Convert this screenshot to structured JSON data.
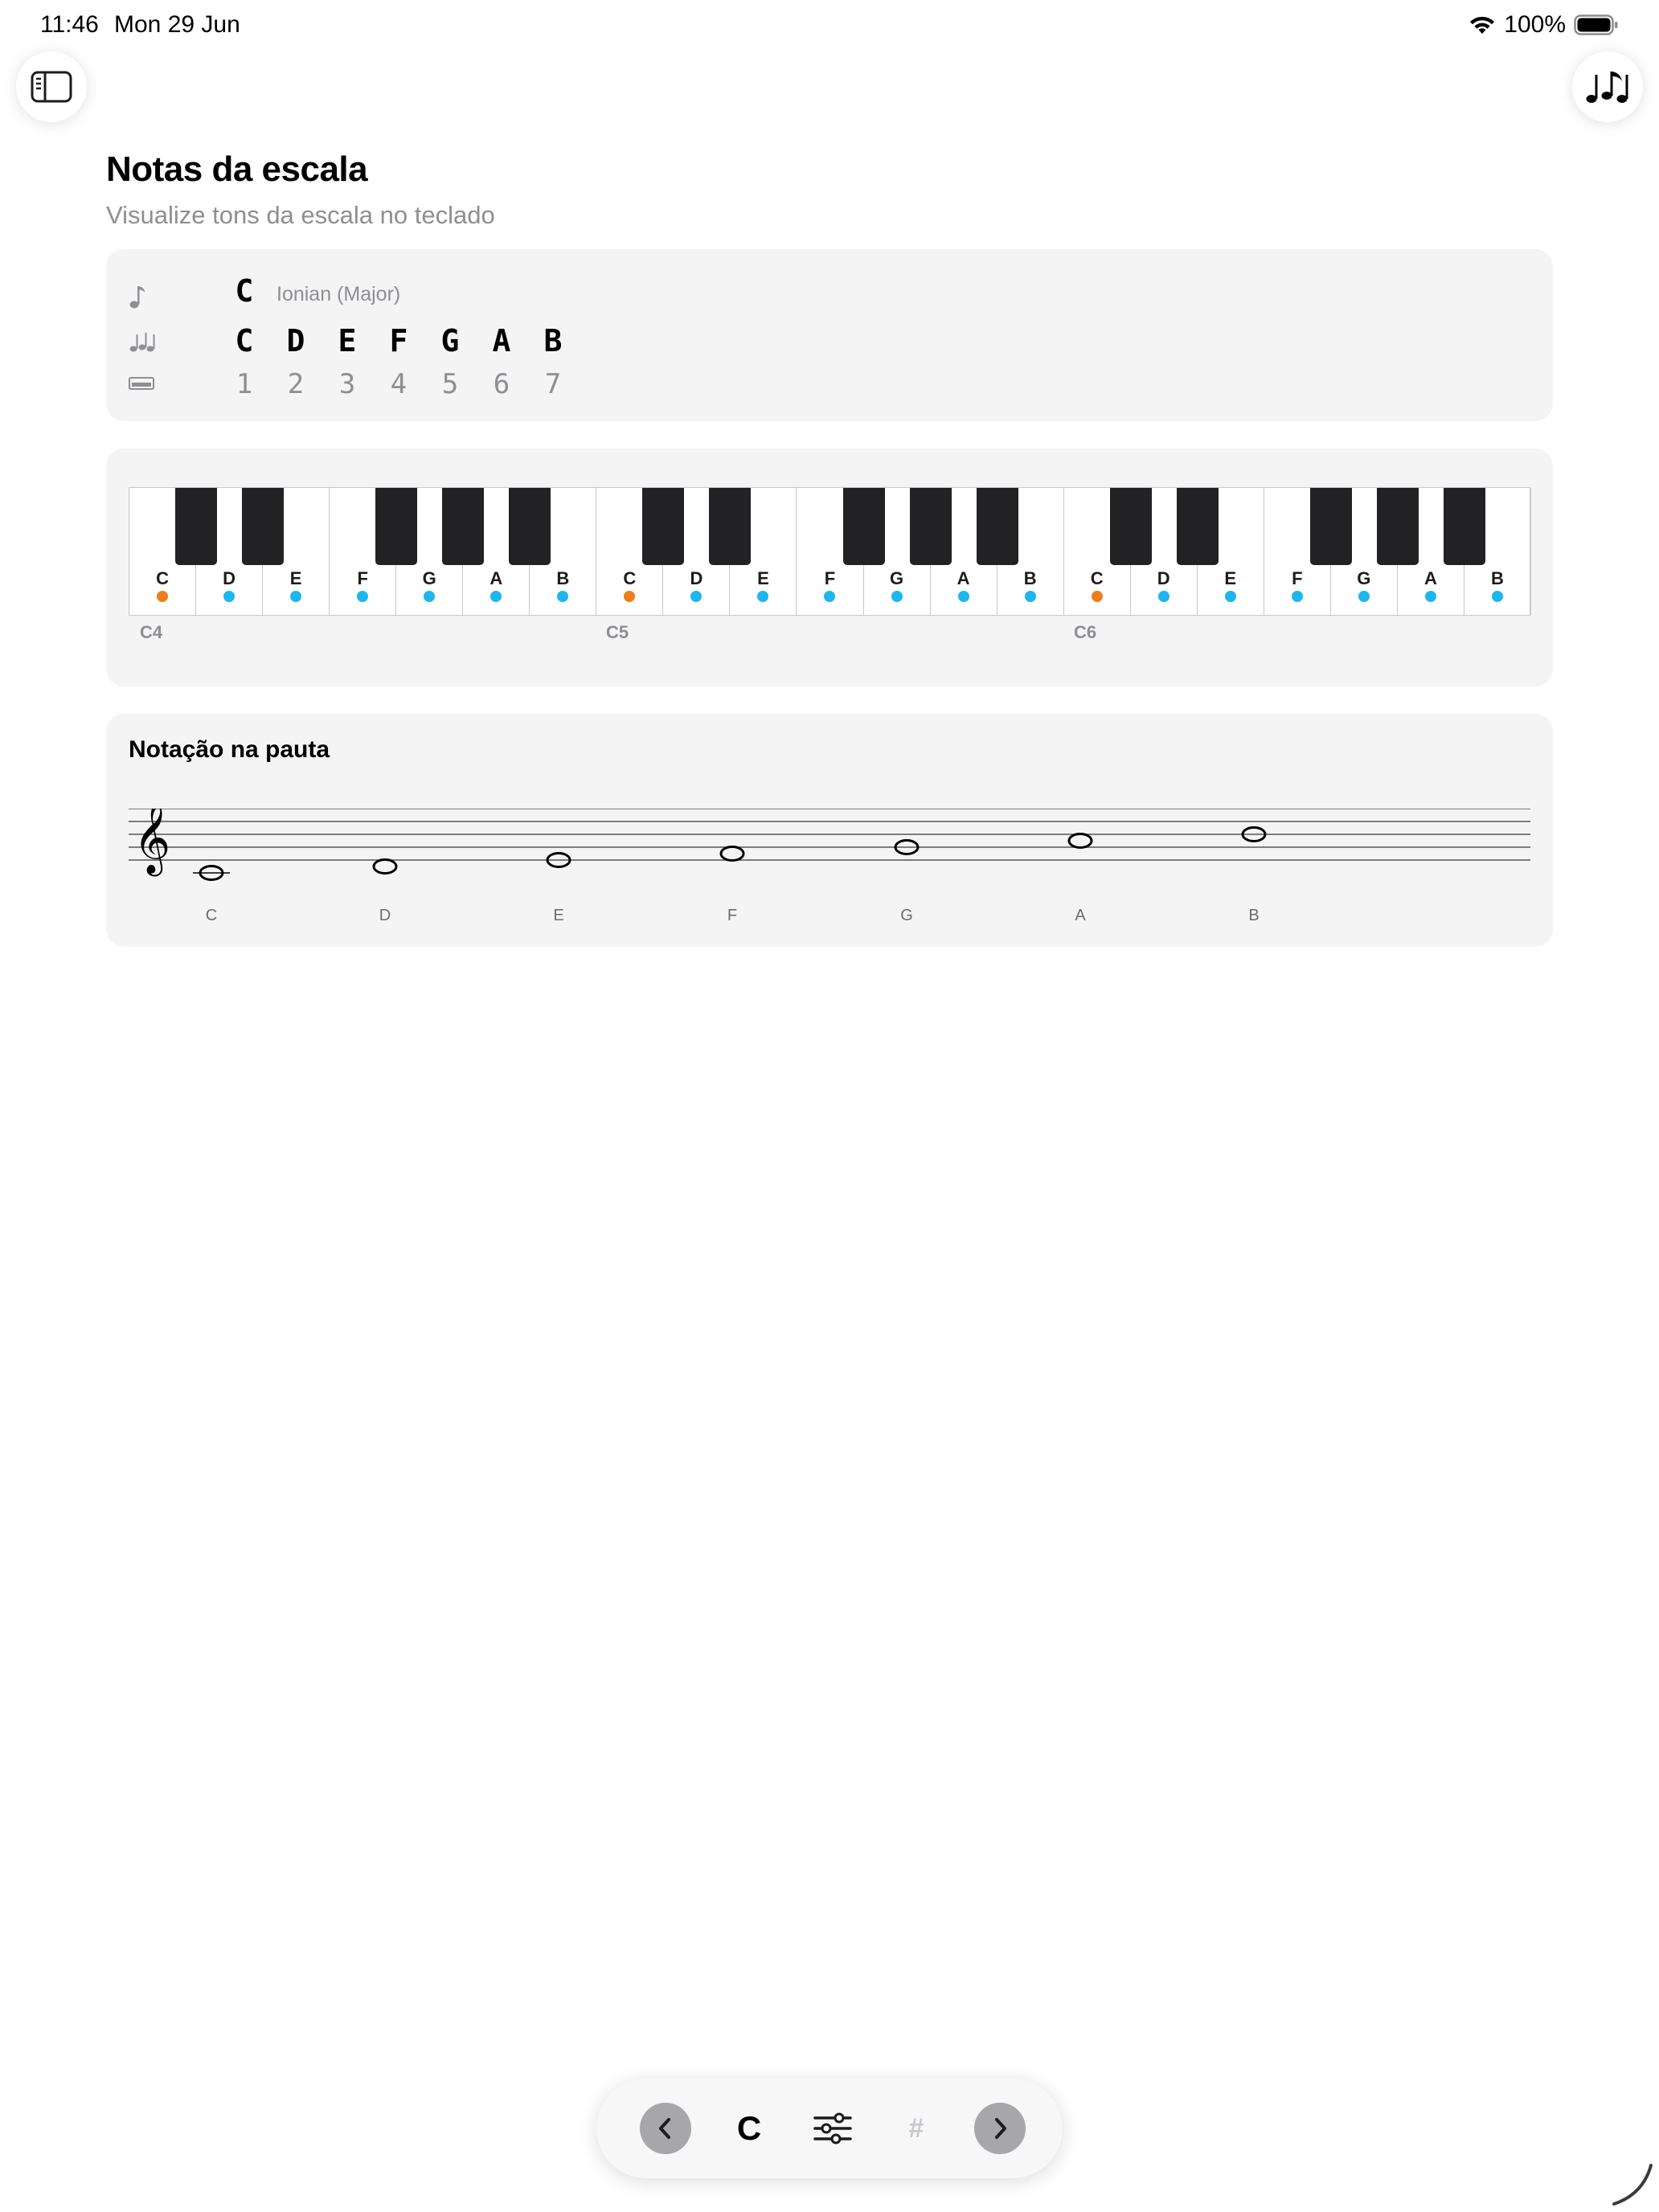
{
  "status_bar": {
    "time": "11:46",
    "date": "Mon 29 Jun",
    "battery": "100%"
  },
  "header": {
    "title": "Notas da escala",
    "subtitle": "Visualize tons da escala no teclado"
  },
  "scale_info": {
    "root": "C",
    "mode": "Ionian (Major)",
    "notes": [
      "C",
      "D",
      "E",
      "F",
      "G",
      "A",
      "B"
    ],
    "degrees": [
      "1",
      "2",
      "3",
      "4",
      "5",
      "6",
      "7"
    ]
  },
  "keyboard": {
    "white_keys": [
      "C",
      "D",
      "E",
      "F",
      "G",
      "A",
      "B",
      "C",
      "D",
      "E",
      "F",
      "G",
      "A",
      "B",
      "C",
      "D",
      "E",
      "F",
      "G",
      "A",
      "B"
    ],
    "octave_labels": [
      "C4",
      "C5",
      "C6"
    ],
    "root_color": "#f07c1a",
    "scale_color": "#1cb6f0"
  },
  "staff": {
    "title": "Notação na pauta",
    "note_labels": [
      "C",
      "D",
      "E",
      "F",
      "G",
      "A",
      "B"
    ]
  },
  "bottom_bar": {
    "key": "C",
    "accidental": "#"
  }
}
